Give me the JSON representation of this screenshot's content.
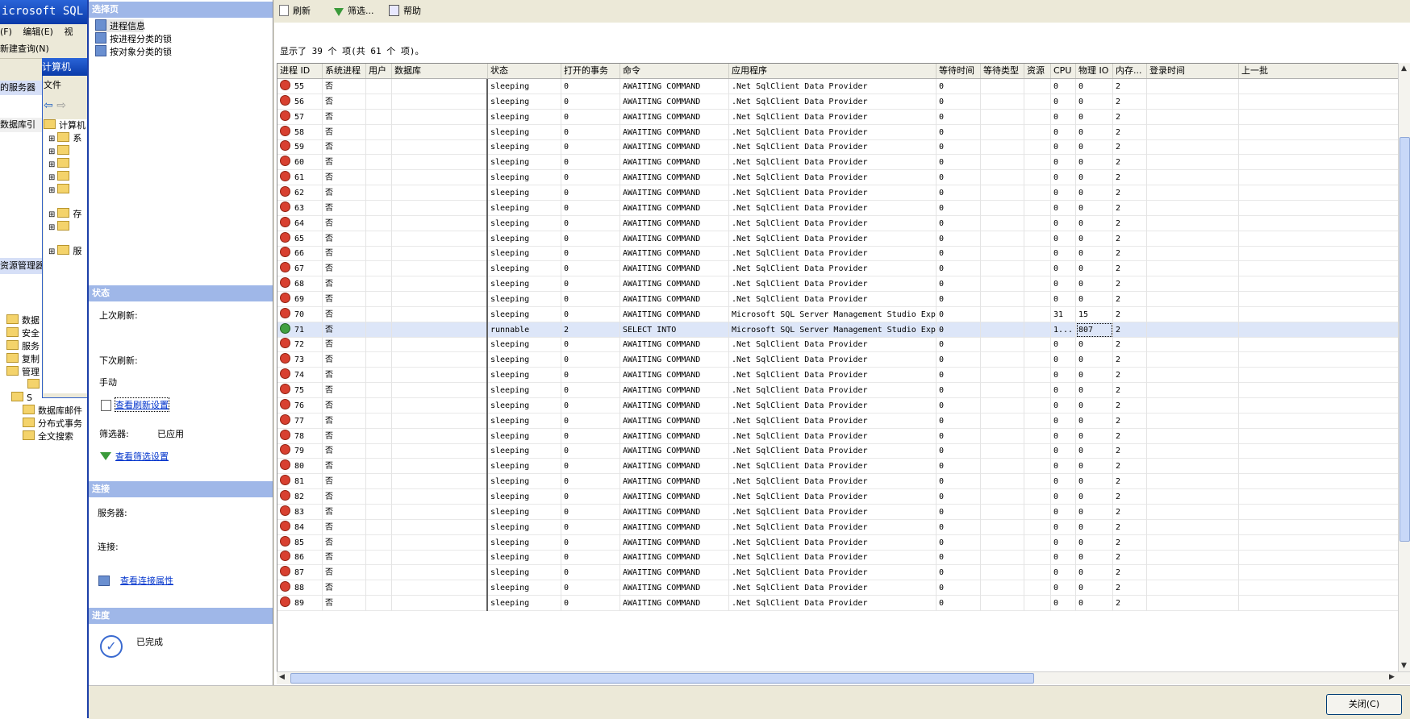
{
  "bg": {
    "title": "icrosoft SQL S",
    "menu": [
      "(F)",
      "编辑(E)",
      "视"
    ],
    "toolbar_label": "新建查询(N)",
    "panel1_header": "的服务器",
    "panel1_row": "数据库引",
    "objexp_header": "资源管理器",
    "tree_items": [
      "数据",
      "安全",
      "服务",
      "复制",
      "管理",
      "",
      "S",
      "数据库邮件",
      "分布式事务",
      "全文搜索"
    ]
  },
  "mid": {
    "title": "计算机",
    "menu_label": "文件",
    "tree_root": "计算机",
    "tree_items": [
      "系",
      "",
      "",
      "",
      "",
      "存",
      "",
      "服"
    ]
  },
  "dialog": {
    "select_page_header": "选择页",
    "pages": [
      "进程信息",
      "按进程分类的锁",
      "按对象分类的锁"
    ],
    "status_header": "状态",
    "last_refresh_label": "上次刷新:",
    "next_refresh_label": "下次刷新:",
    "next_refresh_value": "手动",
    "view_refresh_settings": "查看刷新设置",
    "filter_label": "筛选器:",
    "filter_value": "已应用",
    "view_filter_settings": "查看筛选设置",
    "connection_header": "连接",
    "server_label": "服务器:",
    "connection_label": "连接:",
    "view_connection_props": "查看连接属性",
    "progress_header": "进度",
    "progress_value": "已完成",
    "close_button": "关闭(C)"
  },
  "toolbar": {
    "refresh": "刷新",
    "filter": "筛选...",
    "help": "帮助"
  },
  "count_text": "显示了 39 个 项(共 61 个 项)。",
  "columns": [
    "进程 ID",
    "系统进程",
    "用户",
    "数据库",
    "状态",
    "打开的事务",
    "命令",
    "应用程序",
    "等待时间",
    "等待类型",
    "资源",
    "CPU",
    "物理 IO",
    "内存...",
    "登录时间",
    "上一批"
  ],
  "rows": [
    {
      "id": "55",
      "sys": "否",
      "status": "sleeping",
      "tran": "0",
      "cmd": "AWAITING COMMAND",
      "app": ".Net SqlClient Data Provider",
      "wait": "0",
      "cpu": "0",
      "io": "0",
      "mem": "2"
    },
    {
      "id": "56",
      "sys": "否",
      "status": "sleeping",
      "tran": "0",
      "cmd": "AWAITING COMMAND",
      "app": ".Net SqlClient Data Provider",
      "wait": "0",
      "cpu": "0",
      "io": "0",
      "mem": "2"
    },
    {
      "id": "57",
      "sys": "否",
      "status": "sleeping",
      "tran": "0",
      "cmd": "AWAITING COMMAND",
      "app": ".Net SqlClient Data Provider",
      "wait": "0",
      "cpu": "0",
      "io": "0",
      "mem": "2"
    },
    {
      "id": "58",
      "sys": "否",
      "status": "sleeping",
      "tran": "0",
      "cmd": "AWAITING COMMAND",
      "app": ".Net SqlClient Data Provider",
      "wait": "0",
      "cpu": "0",
      "io": "0",
      "mem": "2"
    },
    {
      "id": "59",
      "sys": "否",
      "status": "sleeping",
      "tran": "0",
      "cmd": "AWAITING COMMAND",
      "app": ".Net SqlClient Data Provider",
      "wait": "0",
      "cpu": "0",
      "io": "0",
      "mem": "2"
    },
    {
      "id": "60",
      "sys": "否",
      "status": "sleeping",
      "tran": "0",
      "cmd": "AWAITING COMMAND",
      "app": ".Net SqlClient Data Provider",
      "wait": "0",
      "cpu": "0",
      "io": "0",
      "mem": "2"
    },
    {
      "id": "61",
      "sys": "否",
      "status": "sleeping",
      "tran": "0",
      "cmd": "AWAITING COMMAND",
      "app": ".Net SqlClient Data Provider",
      "wait": "0",
      "cpu": "0",
      "io": "0",
      "mem": "2"
    },
    {
      "id": "62",
      "sys": "否",
      "status": "sleeping",
      "tran": "0",
      "cmd": "AWAITING COMMAND",
      "app": ".Net SqlClient Data Provider",
      "wait": "0",
      "cpu": "0",
      "io": "0",
      "mem": "2"
    },
    {
      "id": "63",
      "sys": "否",
      "status": "sleeping",
      "tran": "0",
      "cmd": "AWAITING COMMAND",
      "app": ".Net SqlClient Data Provider",
      "wait": "0",
      "cpu": "0",
      "io": "0",
      "mem": "2"
    },
    {
      "id": "64",
      "sys": "否",
      "status": "sleeping",
      "tran": "0",
      "cmd": "AWAITING COMMAND",
      "app": ".Net SqlClient Data Provider",
      "wait": "0",
      "cpu": "0",
      "io": "0",
      "mem": "2"
    },
    {
      "id": "65",
      "sys": "否",
      "status": "sleeping",
      "tran": "0",
      "cmd": "AWAITING COMMAND",
      "app": ".Net SqlClient Data Provider",
      "wait": "0",
      "cpu": "0",
      "io": "0",
      "mem": "2"
    },
    {
      "id": "66",
      "sys": "否",
      "status": "sleeping",
      "tran": "0",
      "cmd": "AWAITING COMMAND",
      "app": ".Net SqlClient Data Provider",
      "wait": "0",
      "cpu": "0",
      "io": "0",
      "mem": "2"
    },
    {
      "id": "67",
      "sys": "否",
      "status": "sleeping",
      "tran": "0",
      "cmd": "AWAITING COMMAND",
      "app": ".Net SqlClient Data Provider",
      "wait": "0",
      "cpu": "0",
      "io": "0",
      "mem": "2"
    },
    {
      "id": "68",
      "sys": "否",
      "status": "sleeping",
      "tran": "0",
      "cmd": "AWAITING COMMAND",
      "app": ".Net SqlClient Data Provider",
      "wait": "0",
      "cpu": "0",
      "io": "0",
      "mem": "2"
    },
    {
      "id": "69",
      "sys": "否",
      "status": "sleeping",
      "tran": "0",
      "cmd": "AWAITING COMMAND",
      "app": ".Net SqlClient Data Provider",
      "wait": "0",
      "cpu": "0",
      "io": "0",
      "mem": "2"
    },
    {
      "id": "70",
      "sys": "否",
      "status": "sleeping",
      "tran": "0",
      "cmd": "AWAITING COMMAND",
      "app": "Microsoft SQL Server Management Studio Express",
      "wait": "0",
      "cpu": "31",
      "io": "15",
      "mem": "2"
    },
    {
      "id": "71",
      "sys": "否",
      "status": "runnable",
      "tran": "2",
      "cmd": "SELECT INTO",
      "app": "Microsoft SQL Server Management Studio Express",
      "wait": "0",
      "cpu": "1...",
      "io": "807",
      "mem": "2",
      "selected": true
    },
    {
      "id": "72",
      "sys": "否",
      "status": "sleeping",
      "tran": "0",
      "cmd": "AWAITING COMMAND",
      "app": ".Net SqlClient Data Provider",
      "wait": "0",
      "cpu": "0",
      "io": "0",
      "mem": "2"
    },
    {
      "id": "73",
      "sys": "否",
      "status": "sleeping",
      "tran": "0",
      "cmd": "AWAITING COMMAND",
      "app": ".Net SqlClient Data Provider",
      "wait": "0",
      "cpu": "0",
      "io": "0",
      "mem": "2"
    },
    {
      "id": "74",
      "sys": "否",
      "status": "sleeping",
      "tran": "0",
      "cmd": "AWAITING COMMAND",
      "app": ".Net SqlClient Data Provider",
      "wait": "0",
      "cpu": "0",
      "io": "0",
      "mem": "2"
    },
    {
      "id": "75",
      "sys": "否",
      "status": "sleeping",
      "tran": "0",
      "cmd": "AWAITING COMMAND",
      "app": ".Net SqlClient Data Provider",
      "wait": "0",
      "cpu": "0",
      "io": "0",
      "mem": "2"
    },
    {
      "id": "76",
      "sys": "否",
      "status": "sleeping",
      "tran": "0",
      "cmd": "AWAITING COMMAND",
      "app": ".Net SqlClient Data Provider",
      "wait": "0",
      "cpu": "0",
      "io": "0",
      "mem": "2"
    },
    {
      "id": "77",
      "sys": "否",
      "status": "sleeping",
      "tran": "0",
      "cmd": "AWAITING COMMAND",
      "app": ".Net SqlClient Data Provider",
      "wait": "0",
      "cpu": "0",
      "io": "0",
      "mem": "2"
    },
    {
      "id": "78",
      "sys": "否",
      "status": "sleeping",
      "tran": "0",
      "cmd": "AWAITING COMMAND",
      "app": ".Net SqlClient Data Provider",
      "wait": "0",
      "cpu": "0",
      "io": "0",
      "mem": "2"
    },
    {
      "id": "79",
      "sys": "否",
      "status": "sleeping",
      "tran": "0",
      "cmd": "AWAITING COMMAND",
      "app": ".Net SqlClient Data Provider",
      "wait": "0",
      "cpu": "0",
      "io": "0",
      "mem": "2"
    },
    {
      "id": "80",
      "sys": "否",
      "status": "sleeping",
      "tran": "0",
      "cmd": "AWAITING COMMAND",
      "app": ".Net SqlClient Data Provider",
      "wait": "0",
      "cpu": "0",
      "io": "0",
      "mem": "2"
    },
    {
      "id": "81",
      "sys": "否",
      "status": "sleeping",
      "tran": "0",
      "cmd": "AWAITING COMMAND",
      "app": ".Net SqlClient Data Provider",
      "wait": "0",
      "cpu": "0",
      "io": "0",
      "mem": "2"
    },
    {
      "id": "82",
      "sys": "否",
      "status": "sleeping",
      "tran": "0",
      "cmd": "AWAITING COMMAND",
      "app": ".Net SqlClient Data Provider",
      "wait": "0",
      "cpu": "0",
      "io": "0",
      "mem": "2"
    },
    {
      "id": "83",
      "sys": "否",
      "status": "sleeping",
      "tran": "0",
      "cmd": "AWAITING COMMAND",
      "app": ".Net SqlClient Data Provider",
      "wait": "0",
      "cpu": "0",
      "io": "0",
      "mem": "2"
    },
    {
      "id": "84",
      "sys": "否",
      "status": "sleeping",
      "tran": "0",
      "cmd": "AWAITING COMMAND",
      "app": ".Net SqlClient Data Provider",
      "wait": "0",
      "cpu": "0",
      "io": "0",
      "mem": "2"
    },
    {
      "id": "85",
      "sys": "否",
      "status": "sleeping",
      "tran": "0",
      "cmd": "AWAITING COMMAND",
      "app": ".Net SqlClient Data Provider",
      "wait": "0",
      "cpu": "0",
      "io": "0",
      "mem": "2"
    },
    {
      "id": "86",
      "sys": "否",
      "status": "sleeping",
      "tran": "0",
      "cmd": "AWAITING COMMAND",
      "app": ".Net SqlClient Data Provider",
      "wait": "0",
      "cpu": "0",
      "io": "0",
      "mem": "2"
    },
    {
      "id": "87",
      "sys": "否",
      "status": "sleeping",
      "tran": "0",
      "cmd": "AWAITING COMMAND",
      "app": ".Net SqlClient Data Provider",
      "wait": "0",
      "cpu": "0",
      "io": "0",
      "mem": "2"
    },
    {
      "id": "88",
      "sys": "否",
      "status": "sleeping",
      "tran": "0",
      "cmd": "AWAITING COMMAND",
      "app": ".Net SqlClient Data Provider",
      "wait": "0",
      "cpu": "0",
      "io": "0",
      "mem": "2"
    },
    {
      "id": "89",
      "sys": "否",
      "status": "sleeping",
      "tran": "0",
      "cmd": "AWAITING COMMAND",
      "app": ".Net SqlClient Data Provider",
      "wait": "0",
      "cpu": "0",
      "io": "0",
      "mem": "2"
    }
  ],
  "icons": {
    "sleeping": "sleeping-process-icon",
    "runnable": "runnable-process-icon",
    "refresh": "refresh-icon",
    "filter": "funnel-icon",
    "help": "help-icon",
    "progress": "checkmark-icon"
  },
  "colors": {
    "title_bar": "#0a3aa8",
    "section_header": "#9fb7e8",
    "selected_row": "#dde6f8",
    "link": "#0033cc"
  }
}
